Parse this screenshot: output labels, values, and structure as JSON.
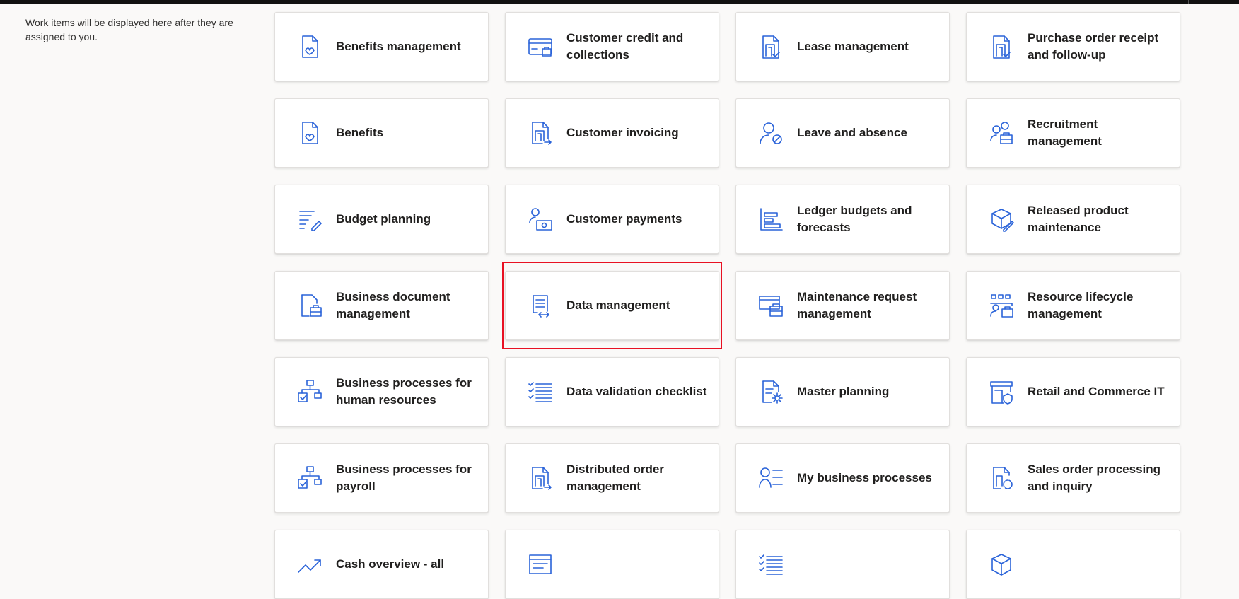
{
  "work_items_note": "Work items will be displayed here after they are assigned to you.",
  "accent_color": "#2a63d9",
  "highlight_color": "#e81123",
  "tiles": [
    {
      "label": "Benefits management",
      "icon": "heart-document-icon"
    },
    {
      "label": "Customer credit and collections",
      "icon": "credit-card-icon"
    },
    {
      "label": "Lease management",
      "icon": "building-document-icon"
    },
    {
      "label": "Purchase order receipt and follow-up",
      "icon": "building-document-icon"
    },
    {
      "label": "Benefits",
      "icon": "heart-document-icon"
    },
    {
      "label": "Customer invoicing",
      "icon": "invoice-arrow-icon"
    },
    {
      "label": "Leave and absence",
      "icon": "person-blocked-icon"
    },
    {
      "label": "Recruitment management",
      "icon": "people-briefcase-icon"
    },
    {
      "label": "Budget planning",
      "icon": "list-pen-icon"
    },
    {
      "label": "Customer payments",
      "icon": "person-money-icon"
    },
    {
      "label": "Ledger budgets and forecasts",
      "icon": "bar-chart-icon"
    },
    {
      "label": "Released product maintenance",
      "icon": "box-pen-icon"
    },
    {
      "label": "Business document management",
      "icon": "document-briefcase-icon"
    },
    {
      "label": "Data management",
      "icon": "document-transfer-icon"
    },
    {
      "label": "Maintenance request management",
      "icon": "window-toolbox-icon"
    },
    {
      "label": "Resource lifecycle management",
      "icon": "resource-people-icon"
    },
    {
      "label": "Business processes for human resources",
      "icon": "flowchart-check-icon"
    },
    {
      "label": "Data validation checklist",
      "icon": "checklist-icon"
    },
    {
      "label": "Master planning",
      "icon": "document-gear-icon"
    },
    {
      "label": "Retail and Commerce IT",
      "icon": "store-shield-icon"
    },
    {
      "label": "Business processes for payroll",
      "icon": "flowchart-check-icon"
    },
    {
      "label": "Distributed order management",
      "icon": "invoice-arrow-icon"
    },
    {
      "label": "My business processes",
      "icon": "person-list-icon"
    },
    {
      "label": "Sales order processing and inquiry",
      "icon": "document-dashed-icon"
    },
    {
      "label": "Cash overview - all",
      "icon": "trend-up-icon"
    },
    {
      "label": "",
      "icon": "window-icon"
    },
    {
      "label": "",
      "icon": "checklist-icon"
    },
    {
      "label": "",
      "icon": "box-icon"
    }
  ]
}
